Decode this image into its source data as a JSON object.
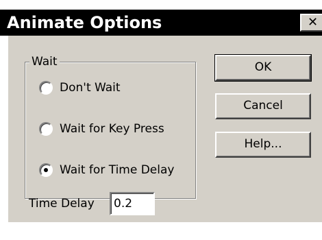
{
  "window": {
    "title": "Animate Options",
    "close_symbol": "✕"
  },
  "wait_group": {
    "legend": "Wait",
    "options": [
      {
        "label": "Don't Wait",
        "selected": false
      },
      {
        "label": "Wait for Key Press",
        "selected": false
      },
      {
        "label": "Wait for Time Delay",
        "selected": true
      }
    ]
  },
  "buttons": {
    "ok_label": "OK",
    "cancel_label": "Cancel",
    "help_label": "Help..."
  },
  "time_delay": {
    "label": "Time Delay",
    "value": "0.2"
  },
  "colors": {
    "title_bar": "#000000",
    "title_text": "#ffffff",
    "dialog_face": "#d4d0c8"
  },
  "icons": {
    "close": "close-icon",
    "radio": "radio-button-icon"
  }
}
